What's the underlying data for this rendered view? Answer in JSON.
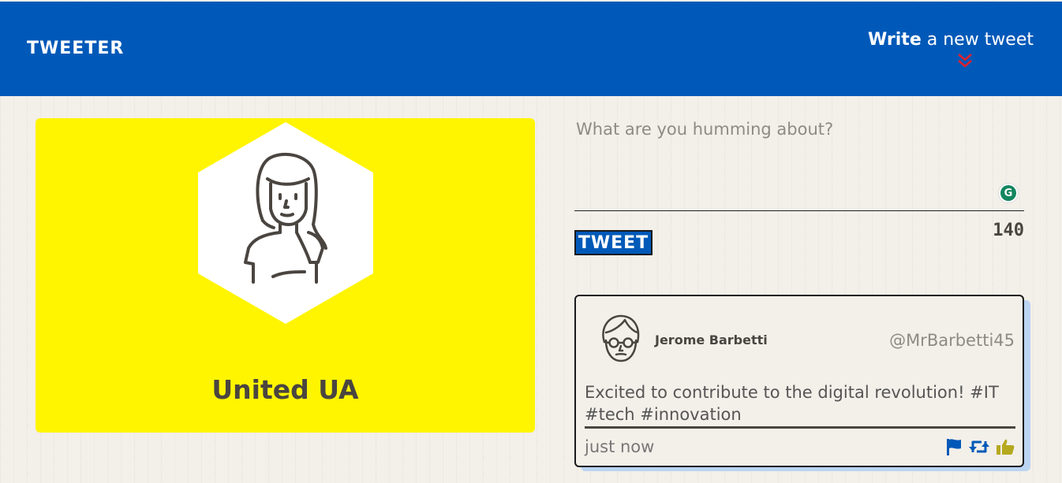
{
  "header": {
    "brand": "TWEETER",
    "write_bold": "Write",
    "write_rest": " a new tweet"
  },
  "profile": {
    "name": "United UA"
  },
  "compose": {
    "placeholder": "What are you humming about?",
    "button_label": "TWEET",
    "char_count": "140"
  },
  "tweet": {
    "author": "Jerome Barbetti",
    "handle": "@MrBarbetti45",
    "text": "Excited to contribute to the digital revolution! #IT #tech #innovation",
    "time": "just now"
  },
  "colors": {
    "header_bg": "#0059b8",
    "profile_bg": "#fff500",
    "accent_red": "#e0212e",
    "flag": "#0059b8",
    "retweet": "#0059b8",
    "like": "#b5a91f"
  },
  "icons": [
    "chevron-down-double-icon",
    "avatar-woman-icon",
    "avatar-man-glasses-icon",
    "flag-icon",
    "retweet-icon",
    "thumbs-up-icon",
    "grammarly-icon"
  ]
}
